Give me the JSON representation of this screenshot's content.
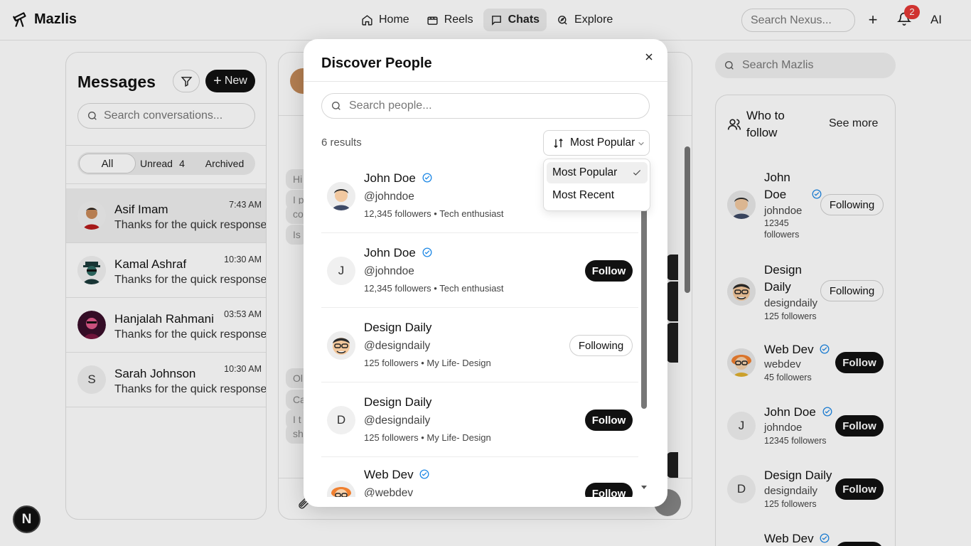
{
  "nav": {
    "brand": "Mazlis",
    "links": [
      {
        "label": "Home",
        "icon": "home-icon"
      },
      {
        "label": "Reels",
        "icon": "reels-icon"
      },
      {
        "label": "Chats",
        "icon": "chat-icon",
        "active": true
      },
      {
        "label": "Explore",
        "icon": "compass-icon"
      }
    ],
    "search_placeholder": "Search Nexus...",
    "notification_count": "2",
    "avatar_initials": "AI"
  },
  "messages": {
    "title": "Messages",
    "new_label": "New",
    "search_placeholder": "Search conversations...",
    "tabs": [
      {
        "label": "All",
        "active": true
      },
      {
        "label": "Unread"
      },
      {
        "label": "4"
      },
      {
        "label": "Archived"
      }
    ],
    "conversations": [
      {
        "name": "Asif Imam",
        "time": "7:43 AM",
        "preview": "Thanks for the quick response!",
        "selected": true
      },
      {
        "name": "Kamal Ashraf",
        "time": "10:30 AM",
        "preview": "Thanks for the quick response!"
      },
      {
        "name": "Hanjalah Rahmani",
        "time": "03:53 AM",
        "preview": "Thanks for the quick response!"
      },
      {
        "name": "Sarah Johnson",
        "time": "10:30 AM",
        "preview": "Thanks for the quick response!",
        "initial": "S"
      }
    ]
  },
  "chat": {
    "bubbles": [
      "Hi",
      "I p",
      "co",
      "Is",
      "Ol",
      "Ca",
      "I t",
      "sh"
    ]
  },
  "right": {
    "search_placeholder": "Search Mazlis",
    "who_to_follow": "Who to follow",
    "see_more": "See more",
    "suggestions": [
      {
        "name": "John Doe",
        "handle": "johndoe",
        "meta": "12345 followers",
        "action": "Following",
        "verified": true
      },
      {
        "name": "Design Daily",
        "handle": "designdaily",
        "meta": "125 followers",
        "action": "Following"
      },
      {
        "name": "Web Dev",
        "handle": "webdev",
        "meta": "45 followers",
        "action": "Follow",
        "verified": true
      },
      {
        "name": "John Doe",
        "handle": "johndoe",
        "meta": "12345 followers",
        "action": "Follow",
        "verified": true,
        "initial": "J"
      },
      {
        "name": "Design Daily",
        "handle": "designdaily",
        "meta": "125 followers",
        "action": "Follow",
        "initial": "D"
      },
      {
        "name": "Web Dev",
        "verified": true
      }
    ]
  },
  "modal": {
    "title": "Discover People",
    "search_placeholder": "Search people...",
    "results": "6 results",
    "sort_selected": "Most Popular",
    "sort_options": [
      "Most Popular",
      "Most Recent"
    ],
    "people": [
      {
        "name": "John Doe",
        "handle": "@johndoe",
        "meta": "12,345 followers • Tech enthusiast",
        "verified": true
      },
      {
        "name": "John Doe",
        "handle": "@johndoe",
        "meta": "12,345 followers • Tech enthusiast",
        "verified": true,
        "action": "Follow",
        "initial": "J"
      },
      {
        "name": "Design Daily",
        "handle": "@designdaily",
        "meta": "125 followers • My Life- Design",
        "action": "Following"
      },
      {
        "name": "Design Daily",
        "handle": "@designdaily",
        "meta": "125 followers • My Life- Design",
        "action": "Follow",
        "initial": "D"
      },
      {
        "name": "Web Dev",
        "handle": "@webdev",
        "meta": "",
        "action": "Follow",
        "verified": true
      }
    ]
  },
  "dev_badge": "N",
  "colors": {
    "accent": "#111111",
    "verified": "#1e88e5",
    "badge": "#e53935"
  }
}
